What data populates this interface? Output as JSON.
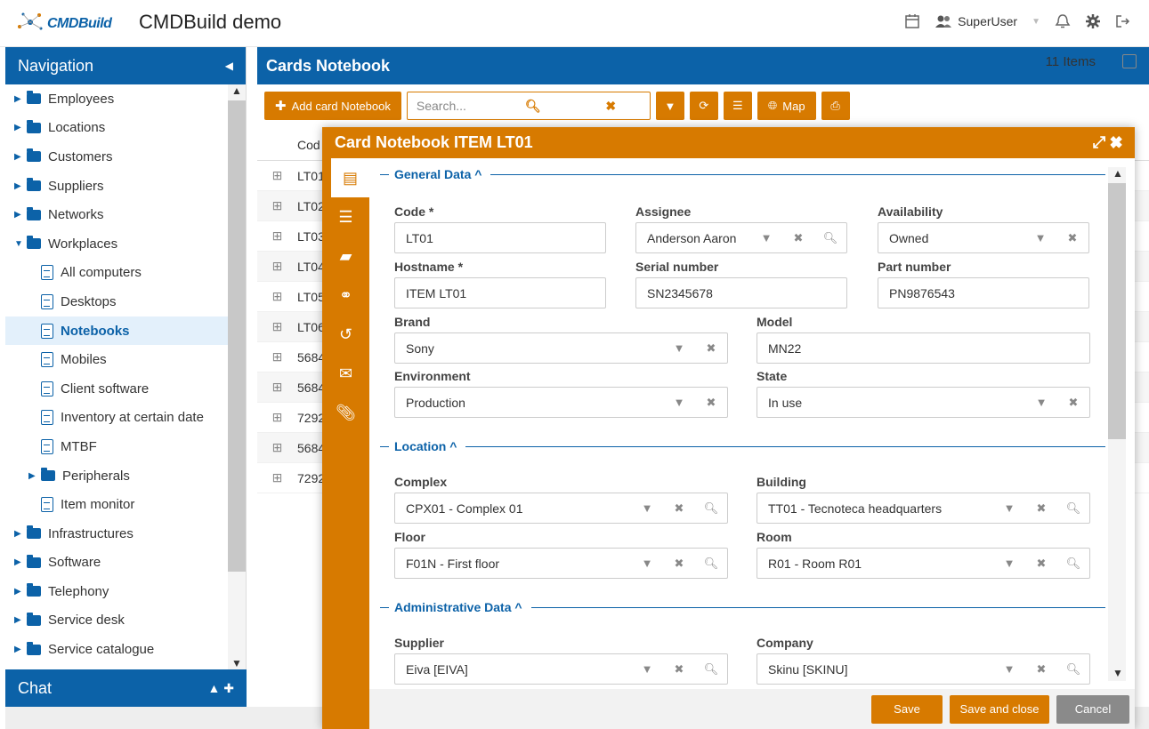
{
  "header": {
    "logo_text": "CMDBuild",
    "app_title": "CMDBuild demo",
    "user": "SuperUser"
  },
  "nav": {
    "title": "Navigation",
    "items": [
      {
        "label": "Employees",
        "type": "folder"
      },
      {
        "label": "Locations",
        "type": "folder"
      },
      {
        "label": "Customers",
        "type": "folder"
      },
      {
        "label": "Suppliers",
        "type": "folder"
      },
      {
        "label": "Networks",
        "type": "folder"
      },
      {
        "label": "Workplaces",
        "type": "folder-open"
      },
      {
        "label": "All computers",
        "type": "child"
      },
      {
        "label": "Desktops",
        "type": "child"
      },
      {
        "label": "Notebooks",
        "type": "child-active"
      },
      {
        "label": "Mobiles",
        "type": "child"
      },
      {
        "label": "Client software",
        "type": "child"
      },
      {
        "label": "Inventory at certain date",
        "type": "child"
      },
      {
        "label": "MTBF",
        "type": "child"
      },
      {
        "label": "Peripherals",
        "type": "child-folder"
      },
      {
        "label": "Item monitor",
        "type": "child"
      },
      {
        "label": "Infrastructures",
        "type": "folder"
      },
      {
        "label": "Software",
        "type": "folder"
      },
      {
        "label": "Telephony",
        "type": "folder"
      },
      {
        "label": "Service desk",
        "type": "folder"
      },
      {
        "label": "Service catalogue",
        "type": "folder"
      }
    ],
    "chat_label": "Chat"
  },
  "main": {
    "title": "Cards Notebook",
    "add_button": "Add card Notebook",
    "search_placeholder": "Search...",
    "map_button": "Map",
    "items_count": "11 Items",
    "grid_header": "Cod",
    "rows": [
      "LT01",
      "LT02",
      "LT03",
      "LT04",
      "LT05",
      "LT06",
      "5684",
      "5684",
      "7292",
      "5684",
      "7292"
    ]
  },
  "modal": {
    "title": "Card Notebook ITEM LT01",
    "sections": {
      "general": "General Data",
      "location": "Location",
      "admin": "Administrative Data"
    },
    "fields": {
      "code": {
        "label": "Code *",
        "value": "LT01"
      },
      "assignee": {
        "label": "Assignee",
        "value": "Anderson Aaron"
      },
      "availability": {
        "label": "Availability",
        "value": "Owned"
      },
      "hostname": {
        "label": "Hostname *",
        "value": "ITEM LT01"
      },
      "serial": {
        "label": "Serial number",
        "value": "SN2345678"
      },
      "part": {
        "label": "Part number",
        "value": "PN9876543"
      },
      "brand": {
        "label": "Brand",
        "value": "Sony"
      },
      "model": {
        "label": "Model",
        "value": "MN22"
      },
      "environment": {
        "label": "Environment",
        "value": "Production"
      },
      "state": {
        "label": "State",
        "value": "In use"
      },
      "complex": {
        "label": "Complex",
        "value": "CPX01 - Complex 01"
      },
      "building": {
        "label": "Building",
        "value": "TT01 - Tecnoteca headquarters"
      },
      "floor": {
        "label": "Floor",
        "value": "F01N - First floor"
      },
      "room": {
        "label": "Room",
        "value": "R01 - Room R01"
      },
      "supplier": {
        "label": "Supplier",
        "value": "Eiva [EIVA]"
      },
      "company": {
        "label": "Company",
        "value": "Skinu [SKINU]"
      }
    },
    "buttons": {
      "save": "Save",
      "save_close": "Save and close",
      "cancel": "Cancel"
    }
  },
  "colors": {
    "primary": "#0c62a8",
    "accent": "#d77a00"
  }
}
